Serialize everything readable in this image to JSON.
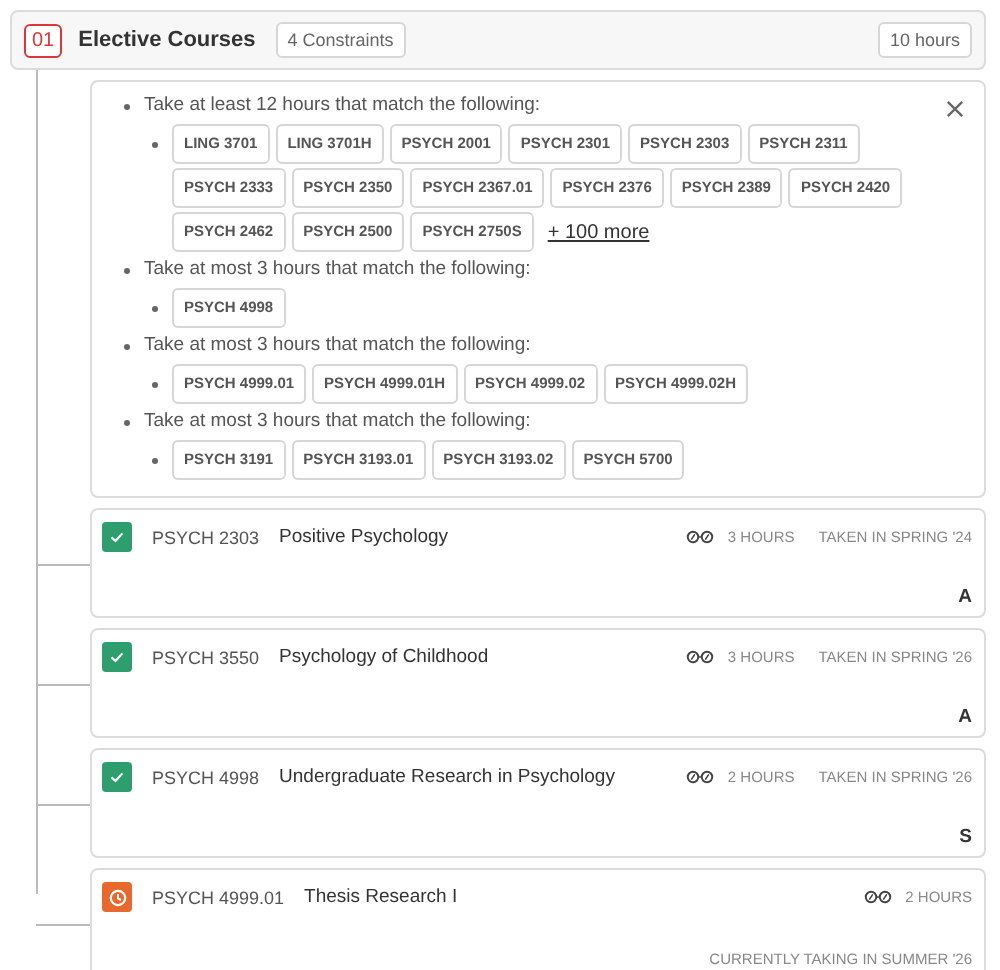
{
  "requirement": {
    "number": "01",
    "title": "Elective Courses",
    "constraints_badge": "4 Constraints",
    "hours": "10 hours"
  },
  "constraints": [
    {
      "text": "Take at least 12 hours that match the following:",
      "courses": [
        "LING 3701",
        "LING 3701H",
        "PSYCH 2001",
        "PSYCH 2301",
        "PSYCH 2303",
        "PSYCH 2311",
        "PSYCH 2333",
        "PSYCH 2350",
        "PSYCH 2367.01",
        "PSYCH 2376",
        "PSYCH 2389",
        "PSYCH 2420",
        "PSYCH 2462",
        "PSYCH 2500",
        "PSYCH 2750S"
      ],
      "more": "+ 100 more"
    },
    {
      "text": "Take at most 3 hours that match the following:",
      "courses": [
        "PSYCH 4998"
      ]
    },
    {
      "text": "Take at most 3 hours that match the following:",
      "courses": [
        "PSYCH 4999.01",
        "PSYCH 4999.01H",
        "PSYCH 4999.02",
        "PSYCH 4999.02H"
      ]
    },
    {
      "text": "Take at most 3 hours that match the following:",
      "courses": [
        "PSYCH 3191",
        "PSYCH 3193.01",
        "PSYCH 3193.02",
        "PSYCH 5700"
      ]
    }
  ],
  "courses": [
    {
      "kind": "completed",
      "code": "PSYCH 2303",
      "title": "Positive Psychology",
      "hours": "3 HOURS",
      "term": "TAKEN IN SPRING '24",
      "grade": "A"
    },
    {
      "kind": "completed",
      "code": "PSYCH 3550",
      "title": "Psychology of Childhood",
      "hours": "3 HOURS",
      "term": "TAKEN IN SPRING '26",
      "grade": "A"
    },
    {
      "kind": "completed",
      "code": "PSYCH 4998",
      "title": "Undergraduate Research in Psychology",
      "hours": "2 HOURS",
      "term": "TAKEN IN SPRING '26",
      "grade": "S"
    },
    {
      "kind": "in_progress",
      "code": "PSYCH 4999.01",
      "title": "Thesis Research I",
      "hours": "2 HOURS",
      "term": "CURRENTLY TAKING IN SUMMER '26"
    }
  ]
}
